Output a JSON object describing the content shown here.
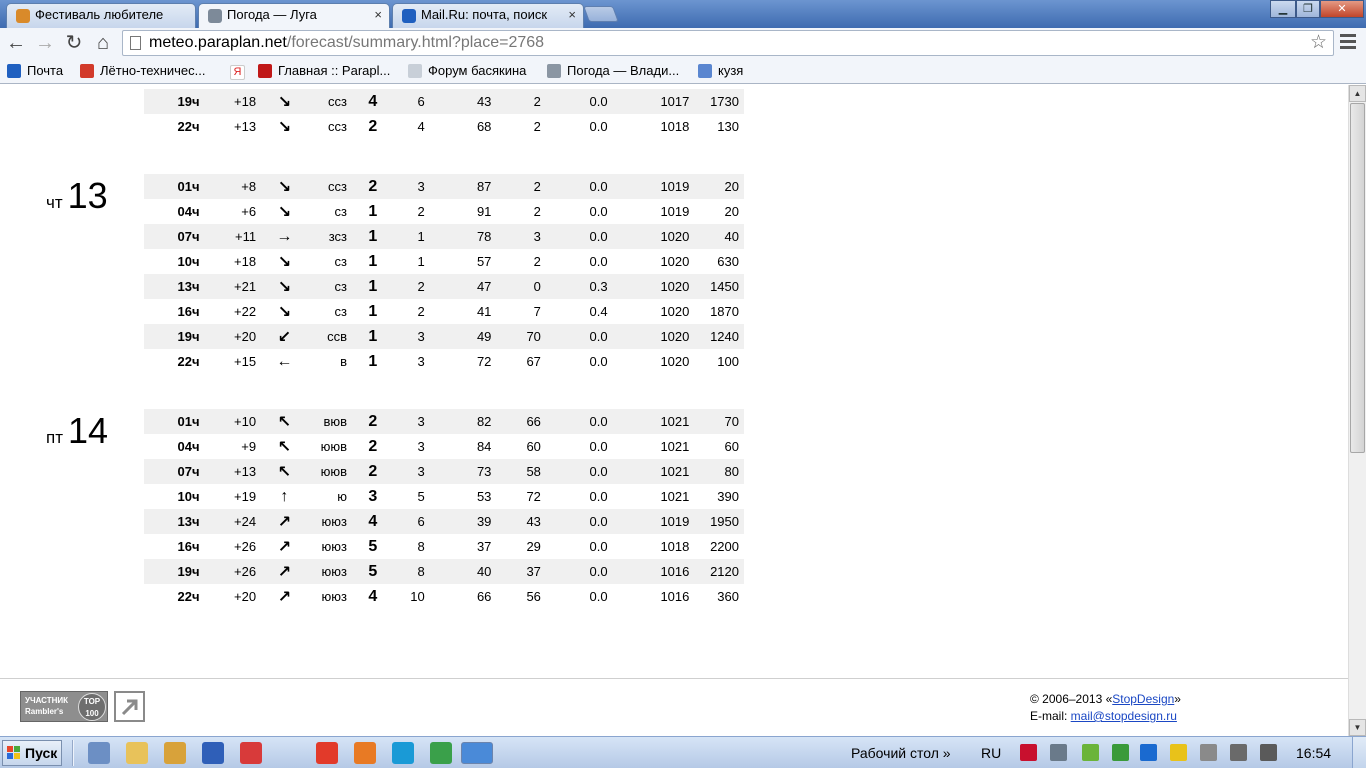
{
  "browser": {
    "tabs": [
      {
        "title": "Фестиваль любителе",
        "favicon_color": "#d98a2a"
      },
      {
        "title": "Погода — Луга",
        "favicon_color": "#7d8a99"
      },
      {
        "title": "Mail.Ru: почта, поиск",
        "favicon_color": "#1f5fbf"
      }
    ],
    "close_glyph": "×",
    "window_controls": {
      "minimize": "▁",
      "maximize": "❐",
      "close": "✕"
    },
    "nav": {
      "back": "←",
      "forward": "→",
      "reload": "↻",
      "home": "⌂"
    },
    "url_host": "meteo.paraplan.net",
    "url_path": "/forecast/summary.html?place=2768",
    "star": "☆",
    "bookmarks": [
      {
        "label": "Почта",
        "icon_color": "#2060c0"
      },
      {
        "label": "Лётно-техничес...",
        "icon_color": "#d23a2a"
      },
      {
        "label": "Я",
        "icon_color": "#d22"
      },
      {
        "label": "Главная :: Parapl...",
        "icon_color": "#c01818"
      },
      {
        "label": "Форум басякина",
        "icon_color": "#c8cfd8"
      },
      {
        "label": "Погода — Влади...",
        "icon_color": "#8b96a3"
      },
      {
        "label": "кузя",
        "icon_color": "#5a86d0"
      }
    ]
  },
  "forecast": {
    "partial": [
      {
        "time": "19ч",
        "temp": "+18",
        "arrow": "↘",
        "dir": "ссз",
        "wind": "4",
        "gust": "6",
        "hum": "43",
        "cloud": "2",
        "prec": "0.0",
        "press": "1017",
        "alt": "1730"
      },
      {
        "time": "22ч",
        "temp": "+13",
        "arrow": "↘",
        "dir": "ссз",
        "wind": "2",
        "gust": "4",
        "hum": "68",
        "cloud": "2",
        "prec": "0.0",
        "press": "1018",
        "alt": "130"
      }
    ],
    "days": [
      {
        "dow": "чт",
        "num": "13",
        "rows": [
          {
            "time": "01ч",
            "temp": "+8",
            "arrow": "↘",
            "dir": "ссз",
            "wind": "2",
            "gust": "3",
            "hum": "87",
            "cloud": "2",
            "prec": "0.0",
            "press": "1019",
            "alt": "20"
          },
          {
            "time": "04ч",
            "temp": "+6",
            "arrow": "↘",
            "dir": "сз",
            "wind": "1",
            "gust": "2",
            "hum": "91",
            "cloud": "2",
            "prec": "0.0",
            "press": "1019",
            "alt": "20"
          },
          {
            "time": "07ч",
            "temp": "+11",
            "arrow": "→",
            "dir": "зсз",
            "wind": "1",
            "gust": "1",
            "hum": "78",
            "cloud": "3",
            "prec": "0.0",
            "press": "1020",
            "alt": "40"
          },
          {
            "time": "10ч",
            "temp": "+18",
            "arrow": "↘",
            "dir": "сз",
            "wind": "1",
            "gust": "1",
            "hum": "57",
            "cloud": "2",
            "prec": "0.0",
            "press": "1020",
            "alt": "630"
          },
          {
            "time": "13ч",
            "temp": "+21",
            "arrow": "↘",
            "dir": "сз",
            "wind": "1",
            "gust": "2",
            "hum": "47",
            "cloud": "0",
            "prec": "0.3",
            "press": "1020",
            "alt": "1450"
          },
          {
            "time": "16ч",
            "temp": "+22",
            "arrow": "↘",
            "dir": "сз",
            "wind": "1",
            "gust": "2",
            "hum": "41",
            "cloud": "7",
            "prec": "0.4",
            "press": "1020",
            "alt": "1870"
          },
          {
            "time": "19ч",
            "temp": "+20",
            "arrow": "↙",
            "dir": "ссв",
            "wind": "1",
            "gust": "3",
            "hum": "49",
            "cloud": "70",
            "prec": "0.0",
            "press": "1020",
            "alt": "1240"
          },
          {
            "time": "22ч",
            "temp": "+15",
            "arrow": "←",
            "dir": "в",
            "wind": "1",
            "gust": "3",
            "hum": "72",
            "cloud": "67",
            "prec": "0.0",
            "press": "1020",
            "alt": "100"
          }
        ]
      },
      {
        "dow": "пт",
        "num": "14",
        "rows": [
          {
            "time": "01ч",
            "temp": "+10",
            "arrow": "↖",
            "dir": "вюв",
            "wind": "2",
            "gust": "3",
            "hum": "82",
            "cloud": "66",
            "prec": "0.0",
            "press": "1021",
            "alt": "70"
          },
          {
            "time": "04ч",
            "temp": "+9",
            "arrow": "↖",
            "dir": "ююв",
            "wind": "2",
            "gust": "3",
            "hum": "84",
            "cloud": "60",
            "prec": "0.0",
            "press": "1021",
            "alt": "60"
          },
          {
            "time": "07ч",
            "temp": "+13",
            "arrow": "↖",
            "dir": "ююв",
            "wind": "2",
            "gust": "3",
            "hum": "73",
            "cloud": "58",
            "prec": "0.0",
            "press": "1021",
            "alt": "80"
          },
          {
            "time": "10ч",
            "temp": "+19",
            "arrow": "↑",
            "dir": "ю",
            "wind": "3",
            "gust": "5",
            "hum": "53",
            "cloud": "72",
            "prec": "0.0",
            "press": "1021",
            "alt": "390"
          },
          {
            "time": "13ч",
            "temp": "+24",
            "arrow": "↗",
            "dir": "ююз",
            "wind": "4",
            "gust": "6",
            "hum": "39",
            "cloud": "43",
            "prec": "0.0",
            "press": "1019",
            "alt": "1950"
          },
          {
            "time": "16ч",
            "temp": "+26",
            "arrow": "↗",
            "dir": "ююз",
            "wind": "5",
            "gust": "8",
            "hum": "37",
            "cloud": "29",
            "prec": "0.0",
            "press": "1018",
            "alt": "2200"
          },
          {
            "time": "19ч",
            "temp": "+26",
            "arrow": "↗",
            "dir": "ююз",
            "wind": "5",
            "gust": "8",
            "hum": "40",
            "cloud": "37",
            "prec": "0.0",
            "press": "1016",
            "alt": "2120"
          },
          {
            "time": "22ч",
            "temp": "+20",
            "arrow": "↗",
            "dir": "ююз",
            "wind": "4",
            "gust": "10",
            "hum": "66",
            "cloud": "56",
            "prec": "0.0",
            "press": "1016",
            "alt": "360"
          }
        ]
      }
    ]
  },
  "footer": {
    "rambler_line1": "УЧАСТНИК",
    "rambler_line2": "Rambler's",
    "rambler_top": "TOP",
    "rambler_num": "100",
    "copyright_prefix": "© 2006–2013 «",
    "copyright_link": "StopDesign",
    "copyright_suffix": "»",
    "email_prefix": "E-mail: ",
    "email_link": "mail@stopdesign.ru"
  },
  "taskbar": {
    "start_label": "Пуск",
    "desktop_label": "Рабочий стол",
    "desktop_chevron": "»",
    "lang": "RU",
    "clock": "16:54",
    "app_icon_colors": [
      "#6c8fc4",
      "#e8c25a",
      "#d8a23a",
      "#2f5fb8",
      "#d83a3a",
      "#e23a2a",
      "#e87a24",
      "#1a9ad6",
      "#3aa04a",
      "#4a8ad8"
    ],
    "tray_icon_colors": [
      "#c8102e",
      "#6a7a8a",
      "#6bb43a",
      "#3a9a3a",
      "#1a6ad0",
      "#e8c21a",
      "#8a8a8a",
      "#6a6a6a",
      "#5a5a5a"
    ]
  }
}
